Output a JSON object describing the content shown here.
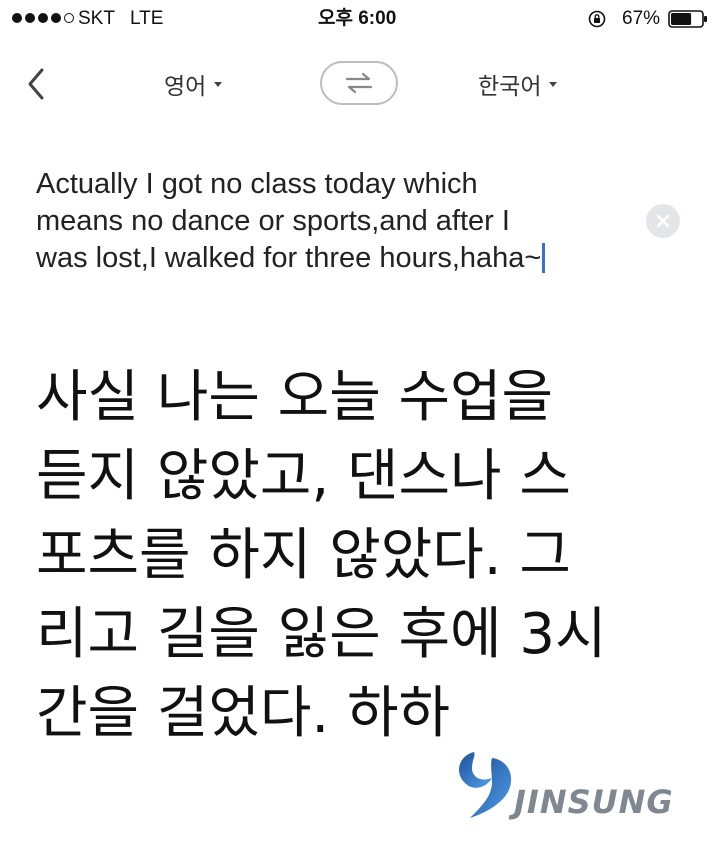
{
  "status_bar": {
    "carrier": "SKT",
    "network": "LTE",
    "time": "오후 6:00",
    "battery_percent": "67%",
    "signal_bars_filled": 4,
    "signal_bars_total": 5,
    "battery_level": 0.67
  },
  "nav": {
    "source_language": "영어",
    "target_language": "한국어",
    "back_icon": "chevron-left-icon",
    "swap_icon": "swap-arrows-icon"
  },
  "input": {
    "text": "Actually I got no class today which\nmeans no dance or sports,and after I\nwas lost,I walked for three hours,haha~",
    "clear_icon": "clear-icon"
  },
  "translation": {
    "text": "사실 나는 오늘 수업을\n듣지 않았고, 댄스나 스\n포츠를 하지 않았다. 그\n리고 길을 잃은 후에 3시\n간을 걸었다. 하하"
  },
  "watermark": {
    "text": "JINSUNG",
    "logo_color": "#2f7fd0"
  },
  "colors": {
    "cursor": "#3a6fd8",
    "swap_border": "#bdbdbd",
    "clear_button_bg": "#e3e5e8"
  }
}
